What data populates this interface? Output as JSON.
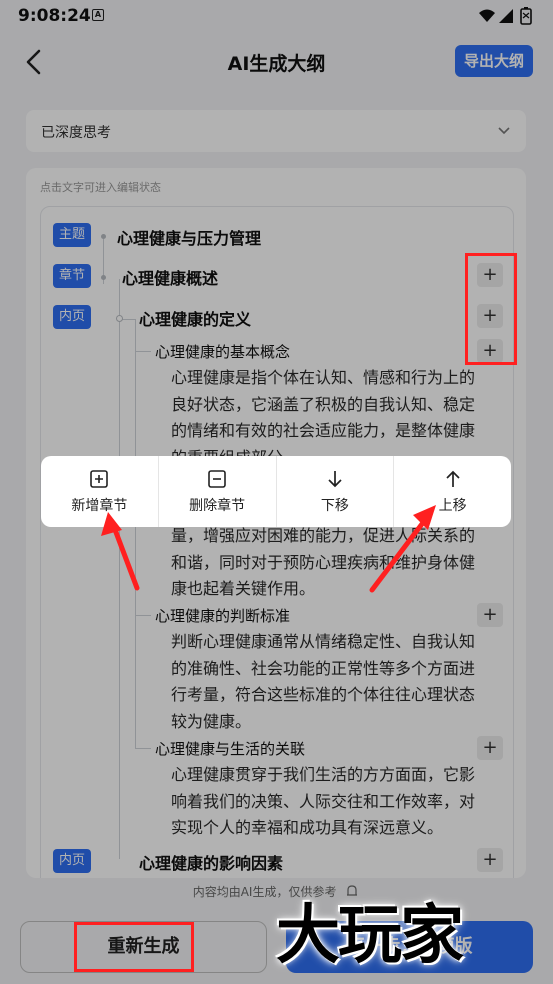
{
  "status_bar": {
    "time": "9:08:24",
    "notif_letter": "A"
  },
  "nav": {
    "title": "AI生成大纲",
    "export_label": "导出大纲"
  },
  "dropdown": {
    "label": "已深度思考"
  },
  "card": {
    "hint": "点击文字可进入编辑状态",
    "topic": {
      "tag": "主题",
      "title": "心理健康与压力管理"
    },
    "chapter": {
      "tag": "章节",
      "title": "心理健康概述"
    },
    "page1": {
      "tag": "内页",
      "title": "心理健康的定义"
    },
    "sub1": {
      "title": "心理健康的基本概念",
      "lines": [
        "心理健康是指个体在认知、情感和行为上的",
        "良好状态，它涵盖了积极的自我认知、稳定",
        "的情绪和有效的社会适应能力，是整体健康",
        "的重要组成部分。"
      ]
    },
    "sub2_partial": {
      "lines": [
        "量，增强应对困难的能力，促进人际关系的",
        "和谐，同时对于预防心理疾病和维护身体健",
        "康也起着关键作用。"
      ]
    },
    "sub3": {
      "title": "心理健康的判断标准",
      "lines": [
        "判断心理健康通常从情绪稳定性、自我认知",
        "的准确性、社会功能的正常性等多个方面进",
        "行考量，符合这些标准的个体往往心理状态",
        "较为健康。"
      ]
    },
    "sub4": {
      "title": "心理健康与生活的关联",
      "lines": [
        "心理健康贯穿于我们生活的方方面面，它影",
        "响着我们的决策、人际交往和工作效率，对",
        "实现个人的幸福和成功具有深远意义。"
      ]
    },
    "page2": {
      "tag": "内页",
      "title": "心理健康的影响因素"
    },
    "plus_symbol": "+"
  },
  "disclaimer": "内容均由AI生成，仅供参考",
  "buttons": {
    "regenerate": "重新生成",
    "next": "下一步：选模版"
  },
  "context_menu": {
    "items": [
      {
        "label": "新增章节",
        "icon": "plus-square-icon"
      },
      {
        "label": "删除章节",
        "icon": "minus-square-icon"
      },
      {
        "label": "下移",
        "icon": "arrow-down-icon"
      },
      {
        "label": "上移",
        "icon": "arrow-up-icon"
      }
    ]
  },
  "watermark": "大玩家",
  "colors": {
    "accent": "#2f6ff2",
    "annotation": "#ff2020",
    "background": "#f2f3f5"
  }
}
